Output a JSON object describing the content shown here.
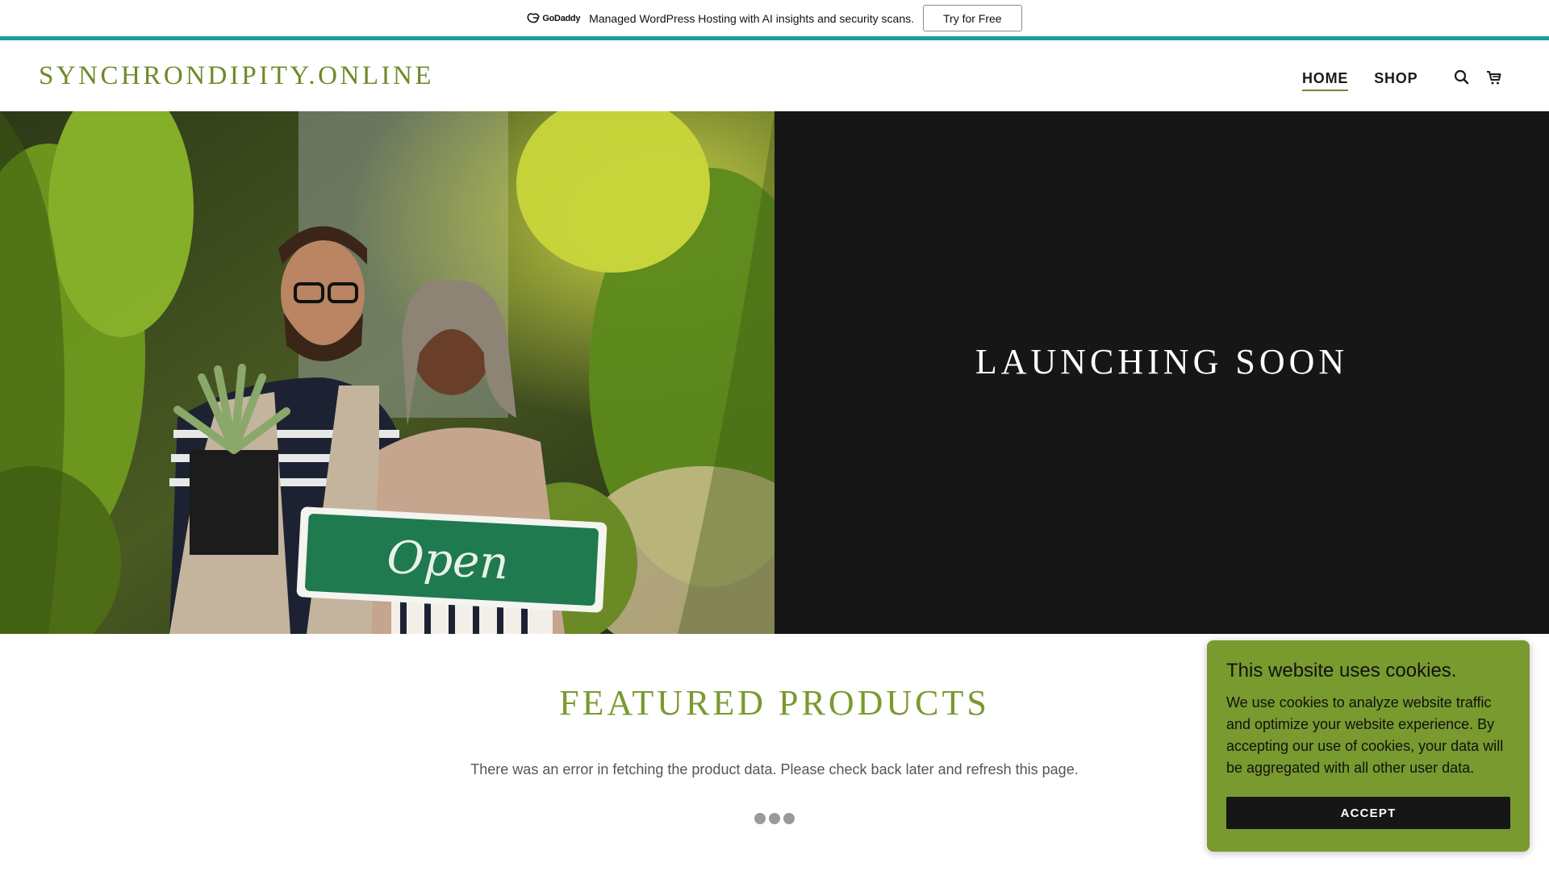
{
  "promo": {
    "brand": "GoDaddy",
    "brand_icon": "godaddy-logo-icon",
    "message": "Managed WordPress Hosting with AI insights and security scans.",
    "cta_label": "Try for Free",
    "accent_color": "#1a9ba5"
  },
  "header": {
    "site_title": "SYNCHRONDIPITY.ONLINE",
    "nav": [
      {
        "label": "HOME",
        "active": true
      },
      {
        "label": "SHOP",
        "active": false
      }
    ],
    "icons": [
      "search-icon",
      "cart-icon"
    ],
    "brand_color": "#6e8a27"
  },
  "hero": {
    "heading": "LAUNCHING SOON",
    "sign_text": "Open",
    "panel_color": "#161616"
  },
  "featured": {
    "title": "FEATURED PRODUCTS",
    "message": "There was an error in fetching the product data. Please check back later and refresh this page.",
    "title_color": "#7a9a2e"
  },
  "cookie": {
    "title": "This website uses cookies.",
    "body": "We use cookies to analyze website traffic and optimize your website experience. By accepting our use of cookies, your data will be aggregated with all other user data.",
    "accept_label": "ACCEPT",
    "background": "#789a2f"
  }
}
